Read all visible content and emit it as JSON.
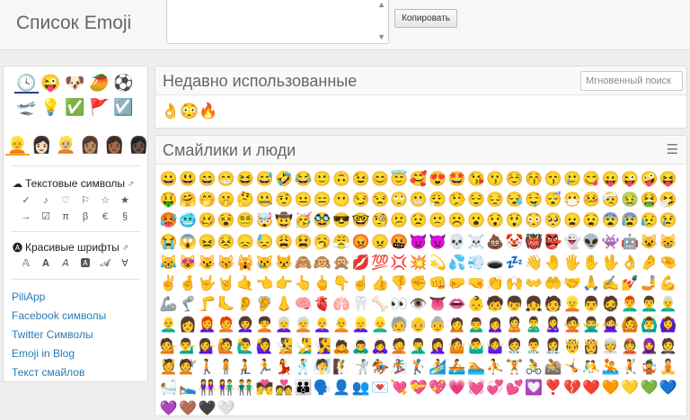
{
  "app": {
    "title": "Список Emoji"
  },
  "toolbar": {
    "copy_label": "Копировать",
    "scroll_up": "▲",
    "scroll_down": "▼"
  },
  "sidebar": {
    "categories_row1": [
      "🕓",
      "😜",
      "🐶",
      "🥭",
      "⚽"
    ],
    "categories_row2": [
      "🛫",
      "💡",
      "✅",
      "🚩",
      "☑️"
    ],
    "skin_tones": [
      "👱",
      "👩🏻",
      "👱🏼",
      "👩🏽",
      "👩🏾",
      "👩🏿"
    ],
    "text_symbols": {
      "heading": "Текстовые символы",
      "icon": "☁",
      "ext": "⇗",
      "symbols": [
        "✓",
        "♪",
        "♡",
        "⚐",
        "☆",
        "★",
        "→",
        "☑",
        "π",
        "β",
        "€",
        "§"
      ]
    },
    "fonts": {
      "heading": "Красивые шрифты",
      "icon": "🅐",
      "ext": "⇗",
      "symbols": [
        "𝔸",
        "𝐀",
        "𝘈",
        "🅰",
        "𝓐",
        "∀"
      ]
    },
    "links": [
      "PiliApp",
      "Facebook символы",
      "Twitter Символы",
      "Emoji in Blog",
      "Текст смайлов"
    ]
  },
  "recent": {
    "title": "Недавно использованные",
    "search_placeholder": "Мгновенный поиск",
    "emojis": [
      "👌",
      "😳",
      "🔥"
    ]
  },
  "smileys": {
    "title": "Смайлики и люди",
    "menu_icon": "☰",
    "emojis": [
      "😀",
      "😃",
      "😄",
      "😁",
      "😆",
      "😅",
      "🤣",
      "😂",
      "🙂",
      "🙃",
      "😉",
      "😊",
      "😇",
      "🥰",
      "😍",
      "🤩",
      "😘",
      "😗",
      "☺️",
      "😚",
      "😙",
      "🥲",
      "😋",
      "😛",
      "😜",
      "🤪",
      "😝",
      "🤑",
      "🤗",
      "🤭",
      "🤫",
      "🤔",
      "🤐",
      "🤨",
      "😐",
      "😑",
      "😶",
      "😏",
      "😒",
      "🙄",
      "😬",
      "😮‍💨",
      "🤥",
      "😌",
      "😔",
      "😪",
      "🤤",
      "😴",
      "😷",
      "🤒",
      "🤕",
      "🤢",
      "🤮",
      "🤧",
      "🥵",
      "🥶",
      "🥴",
      "😵",
      "😵‍💫",
      "🤯",
      "🤠",
      "🥳",
      "🥸",
      "😎",
      "🤓",
      "🧐",
      "😕",
      "😟",
      "🙁",
      "☹️",
      "😮",
      "😯",
      "😲",
      "😳",
      "🥺",
      "😦",
      "😧",
      "😨",
      "😰",
      "😥",
      "😢",
      "😭",
      "😱",
      "😖",
      "😣",
      "😞",
      "😓",
      "😩",
      "😫",
      "🥱",
      "😤",
      "😡",
      "😠",
      "🤬",
      "😈",
      "👿",
      "💀",
      "☠️",
      "💩",
      "🤡",
      "👹",
      "👺",
      "👻",
      "👽",
      "👾",
      "🤖",
      "😺",
      "😸",
      "😹",
      "😻",
      "😼",
      "😽",
      "🙀",
      "😿",
      "😾",
      "🙈",
      "🙉",
      "🙊",
      "💋",
      "💯",
      "💢",
      "💥",
      "💫",
      "💦",
      "💨",
      "🕳️",
      "💤",
      "👋",
      "🤚",
      "🖐️",
      "✋",
      "🖖",
      "👌",
      "🤌",
      "🤏",
      "✌️",
      "🤞",
      "🤟",
      "🤘",
      "🤙",
      "👈",
      "👉",
      "👆",
      "🖕",
      "👇",
      "☝️",
      "👍",
      "👎",
      "✊",
      "👊",
      "🤛",
      "🤜",
      "👏",
      "🙌",
      "👐",
      "🤲",
      "🤝",
      "🙏",
      "✍️",
      "💅",
      "🤳",
      "💪",
      "🦾",
      "🦿",
      "🦵",
      "🦶",
      "👂",
      "🦻",
      "👃",
      "🧠",
      "🫀",
      "🫁",
      "🦷",
      "🦴",
      "👀",
      "👁️",
      "👅",
      "👄",
      "👶",
      "🧒",
      "👦",
      "👧",
      "🧑",
      "👱",
      "👨",
      "🧔",
      "👨‍🦰",
      "👨‍🦱",
      "👨‍🦳",
      "👨‍🦲",
      "👩",
      "👩‍🦰",
      "🧑‍🦰",
      "👩‍🦱",
      "🧑‍🦱",
      "👩‍🦳",
      "🧑‍🦳",
      "👩‍🦲",
      "🧑‍🦲",
      "👱‍♀️",
      "👱‍♂️",
      "🧓",
      "👴",
      "👵",
      "🙍",
      "🙍‍♂️",
      "🙍‍♀️",
      "🙎",
      "🙎‍♂️",
      "🙎‍♀️",
      "🙅",
      "🙅‍♂️",
      "🙅‍♀️",
      "🙆",
      "🙆‍♂️",
      "🙆‍♀️",
      "💁",
      "💁‍♂️",
      "💁‍♀️",
      "🙋",
      "🙋‍♂️",
      "🙋‍♀️",
      "🧏",
      "🧏‍♂️",
      "🧏‍♀️",
      "🙇",
      "🙇‍♂️",
      "🙇‍♀️",
      "🤦",
      "🤦‍♂️",
      "🤦‍♀️",
      "🤷",
      "🤷‍♂️",
      "🤷‍♀️",
      "🧑‍⚕️",
      "👨‍⚕️",
      "👩‍⚕️",
      "🤴",
      "👸",
      "👳",
      "👲",
      "🧕",
      "🤵",
      "💆",
      "💇",
      "🚶",
      "🧍",
      "🧎",
      "🏃",
      "💃",
      "🕺",
      "🧖",
      "🧗",
      "🤺",
      "🏇",
      "🏂",
      "🏌️",
      "🏄",
      "🚣",
      "🏊",
      "⛹️",
      "🏋️",
      "🚴",
      "🚵",
      "🤸",
      "🤼",
      "🤽",
      "🤾",
      "🤹",
      "🧘",
      "🛀",
      "🛌",
      "👭",
      "👫",
      "👬",
      "💏",
      "💑",
      "👪",
      "🗣️",
      "👤",
      "👥",
      "💌",
      "💘",
      "💝",
      "💖",
      "💗",
      "💓",
      "💞",
      "💕",
      "💟",
      "❣️",
      "💔",
      "❤️",
      "🧡",
      "💛",
      "💚",
      "💙",
      "💜",
      "🤎",
      "🖤",
      "🤍"
    ]
  }
}
